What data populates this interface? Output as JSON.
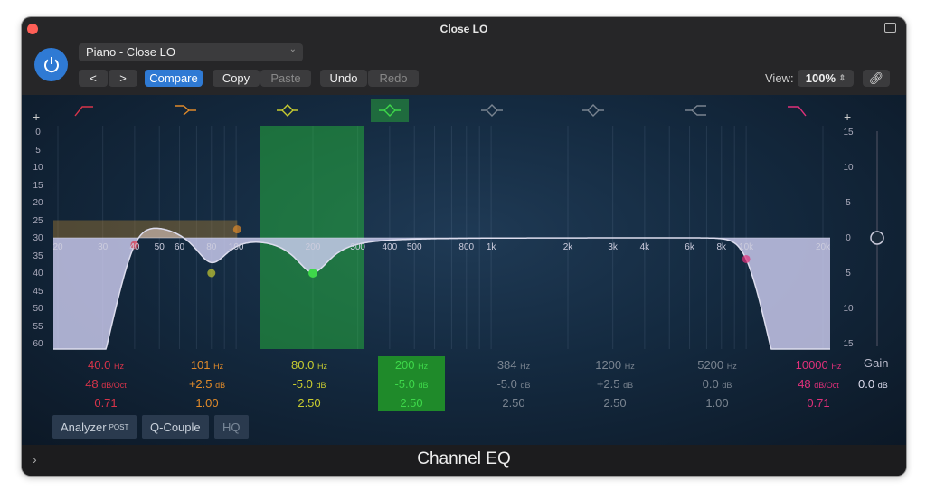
{
  "window": {
    "title": "Close LO",
    "plugin_name": "Channel EQ"
  },
  "header": {
    "preset": "Piano - Close LO",
    "prev": "<",
    "next": ">",
    "compare": "Compare",
    "copy": "Copy",
    "paste": "Paste",
    "undo": "Undo",
    "redo": "Redo",
    "view_label": "View:",
    "view_value": "100%"
  },
  "colors": {
    "accent": "#2f7ad4",
    "band1": "#d8344a",
    "band2": "#e08a2a",
    "band3": "#c8cc30",
    "band4": "#3ed84a",
    "disabled": "#7a8490",
    "band8": "#e0307a"
  },
  "left_scale": [
    "0",
    "5",
    "10",
    "15",
    "20",
    "25",
    "30",
    "35",
    "40",
    "45",
    "50",
    "55",
    "60"
  ],
  "right_scale": [
    "15",
    "10",
    "5",
    "0",
    "5",
    "10",
    "15"
  ],
  "freq_labels": [
    "20",
    "30",
    "40",
    "50",
    "60",
    "80",
    "100",
    "200",
    "300",
    "400",
    "500",
    "800",
    "1k",
    "2k",
    "3k",
    "4k",
    "6k",
    "8k",
    "10k",
    "20k"
  ],
  "bands": [
    {
      "type": "low-cut",
      "freq": "40.0",
      "freq_unit": "Hz",
      "gain": "48",
      "gain_unit": "dB/Oct",
      "q": "0.71",
      "enabled": true
    },
    {
      "type": "low-shelf",
      "freq": "101",
      "freq_unit": "Hz",
      "gain": "+2.5",
      "gain_unit": "dB",
      "q": "1.00",
      "enabled": true
    },
    {
      "type": "bell",
      "freq": "80.0",
      "freq_unit": "Hz",
      "gain": "-5.0",
      "gain_unit": "dB",
      "q": "2.50",
      "enabled": true
    },
    {
      "type": "bell",
      "freq": "200",
      "freq_unit": "Hz",
      "gain": "-5.0",
      "gain_unit": "dB",
      "q": "2.50",
      "enabled": true,
      "selected": true
    },
    {
      "type": "bell",
      "freq": "384",
      "freq_unit": "Hz",
      "gain": "-5.0",
      "gain_unit": "dB",
      "q": "2.50",
      "enabled": false
    },
    {
      "type": "bell",
      "freq": "1200",
      "freq_unit": "Hz",
      "gain": "+2.5",
      "gain_unit": "dB",
      "q": "2.50",
      "enabled": false
    },
    {
      "type": "high-shelf",
      "freq": "5200",
      "freq_unit": "Hz",
      "gain": "0.0",
      "gain_unit": "dB",
      "q": "1.00",
      "enabled": false
    },
    {
      "type": "high-cut",
      "freq": "10000",
      "freq_unit": "Hz",
      "gain": "48",
      "gain_unit": "dB/Oct",
      "q": "0.71",
      "enabled": true
    }
  ],
  "gain": {
    "label": "Gain",
    "value": "0.0",
    "unit": "dB"
  },
  "footer_buttons": {
    "analyzer": "Analyzer",
    "analyzer_mode": "POST",
    "qcouple": "Q-Couple",
    "hq": "HQ"
  },
  "plus": "+"
}
